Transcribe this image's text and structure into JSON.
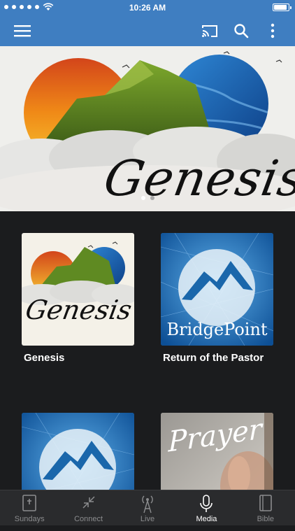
{
  "status_bar": {
    "time": "10:26 AM",
    "battery_fraction": 0.95
  },
  "app_bar": {
    "icons": [
      "menu-icon",
      "cast-icon",
      "search-icon",
      "more-vertical-icon"
    ],
    "color": "#3f7ec1"
  },
  "hero": {
    "title": "Genesis",
    "pager": {
      "count": 2,
      "active": 0
    }
  },
  "cards": [
    {
      "title": "Genesis",
      "art_text": "Genesis"
    },
    {
      "title": "Return of the Pastor",
      "art_text": "BridgePoint"
    },
    {
      "title": "",
      "art_text": ""
    },
    {
      "title": "",
      "art_text": "Prayer"
    }
  ],
  "tabs": [
    {
      "label": "Sundays",
      "icon": "book-icon",
      "active": false
    },
    {
      "label": "Connect",
      "icon": "connect-arrows-icon",
      "active": false
    },
    {
      "label": "Live",
      "icon": "antenna-icon",
      "active": false
    },
    {
      "label": "Media",
      "icon": "microphone-icon",
      "active": true
    },
    {
      "label": "Bible",
      "icon": "bible-icon",
      "active": false
    }
  ]
}
